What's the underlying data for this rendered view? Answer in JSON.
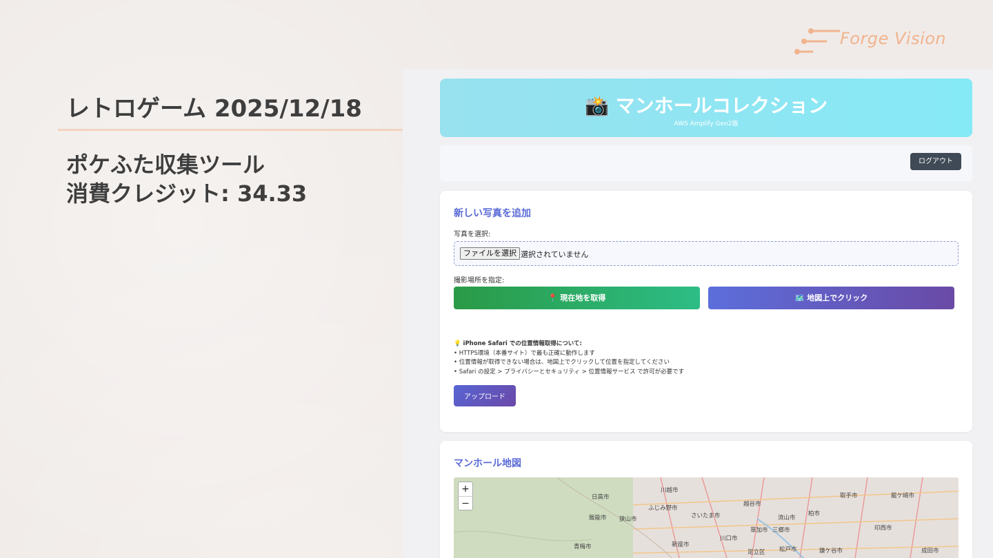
{
  "slide": {
    "title": "レトロゲーム 2025/12/18",
    "subtitle_line1": "ポケふた収集ツール",
    "subtitle_line2": "消費クレジット: 34.33",
    "logo_text": "Forge Vision"
  },
  "app": {
    "title": "📸 マンホールコレクション",
    "subtitle": "AWS Amplify Gen2版",
    "logout_label": "ログアウト"
  },
  "add_photo": {
    "title": "新しい写真を追加",
    "select_label": "写真を選択:",
    "file_button": "ファイルを選択",
    "file_status": "選択されていません",
    "location_label": "撮影場所を指定:",
    "current_location_button": "📍 現在地を取得",
    "map_click_button": "🗺️ 地図上でクリック",
    "notes_heading": "💡 iPhone Safari での位置情報取得について:",
    "notes": [
      "• HTTPS環境（本番サイト）で最も正確に動作します",
      "• 位置情報が取得できない場合は、地図上でクリックして位置を指定してください",
      "• Safari の設定 > プライバシーとセキュリティ > 位置情報サービス で許可が必要です"
    ],
    "upload_button": "アップロード"
  },
  "map_section": {
    "title": "マンホール地図",
    "zoom_in": "+",
    "zoom_out": "−",
    "cities": [
      "日高市",
      "川越市",
      "ふじみ野市",
      "越谷市",
      "取手市",
      "龍ケ崎市",
      "飯能市",
      "狭山市",
      "さいたま市",
      "流山市",
      "柏市",
      "草加市",
      "三郷市",
      "印西市",
      "川口市",
      "青梅市",
      "新座市",
      "足立区",
      "松戸市",
      "鎌ケ谷市",
      "成田市"
    ]
  },
  "colors": {
    "accent_blue": "#5a6bd6",
    "header_cyan": "#8ee6f3",
    "green_button": "#2dbd86",
    "purple_button": "#6a4aa6",
    "logout_dark": "#3f4a56",
    "logo_peach": "#f1b48e"
  }
}
